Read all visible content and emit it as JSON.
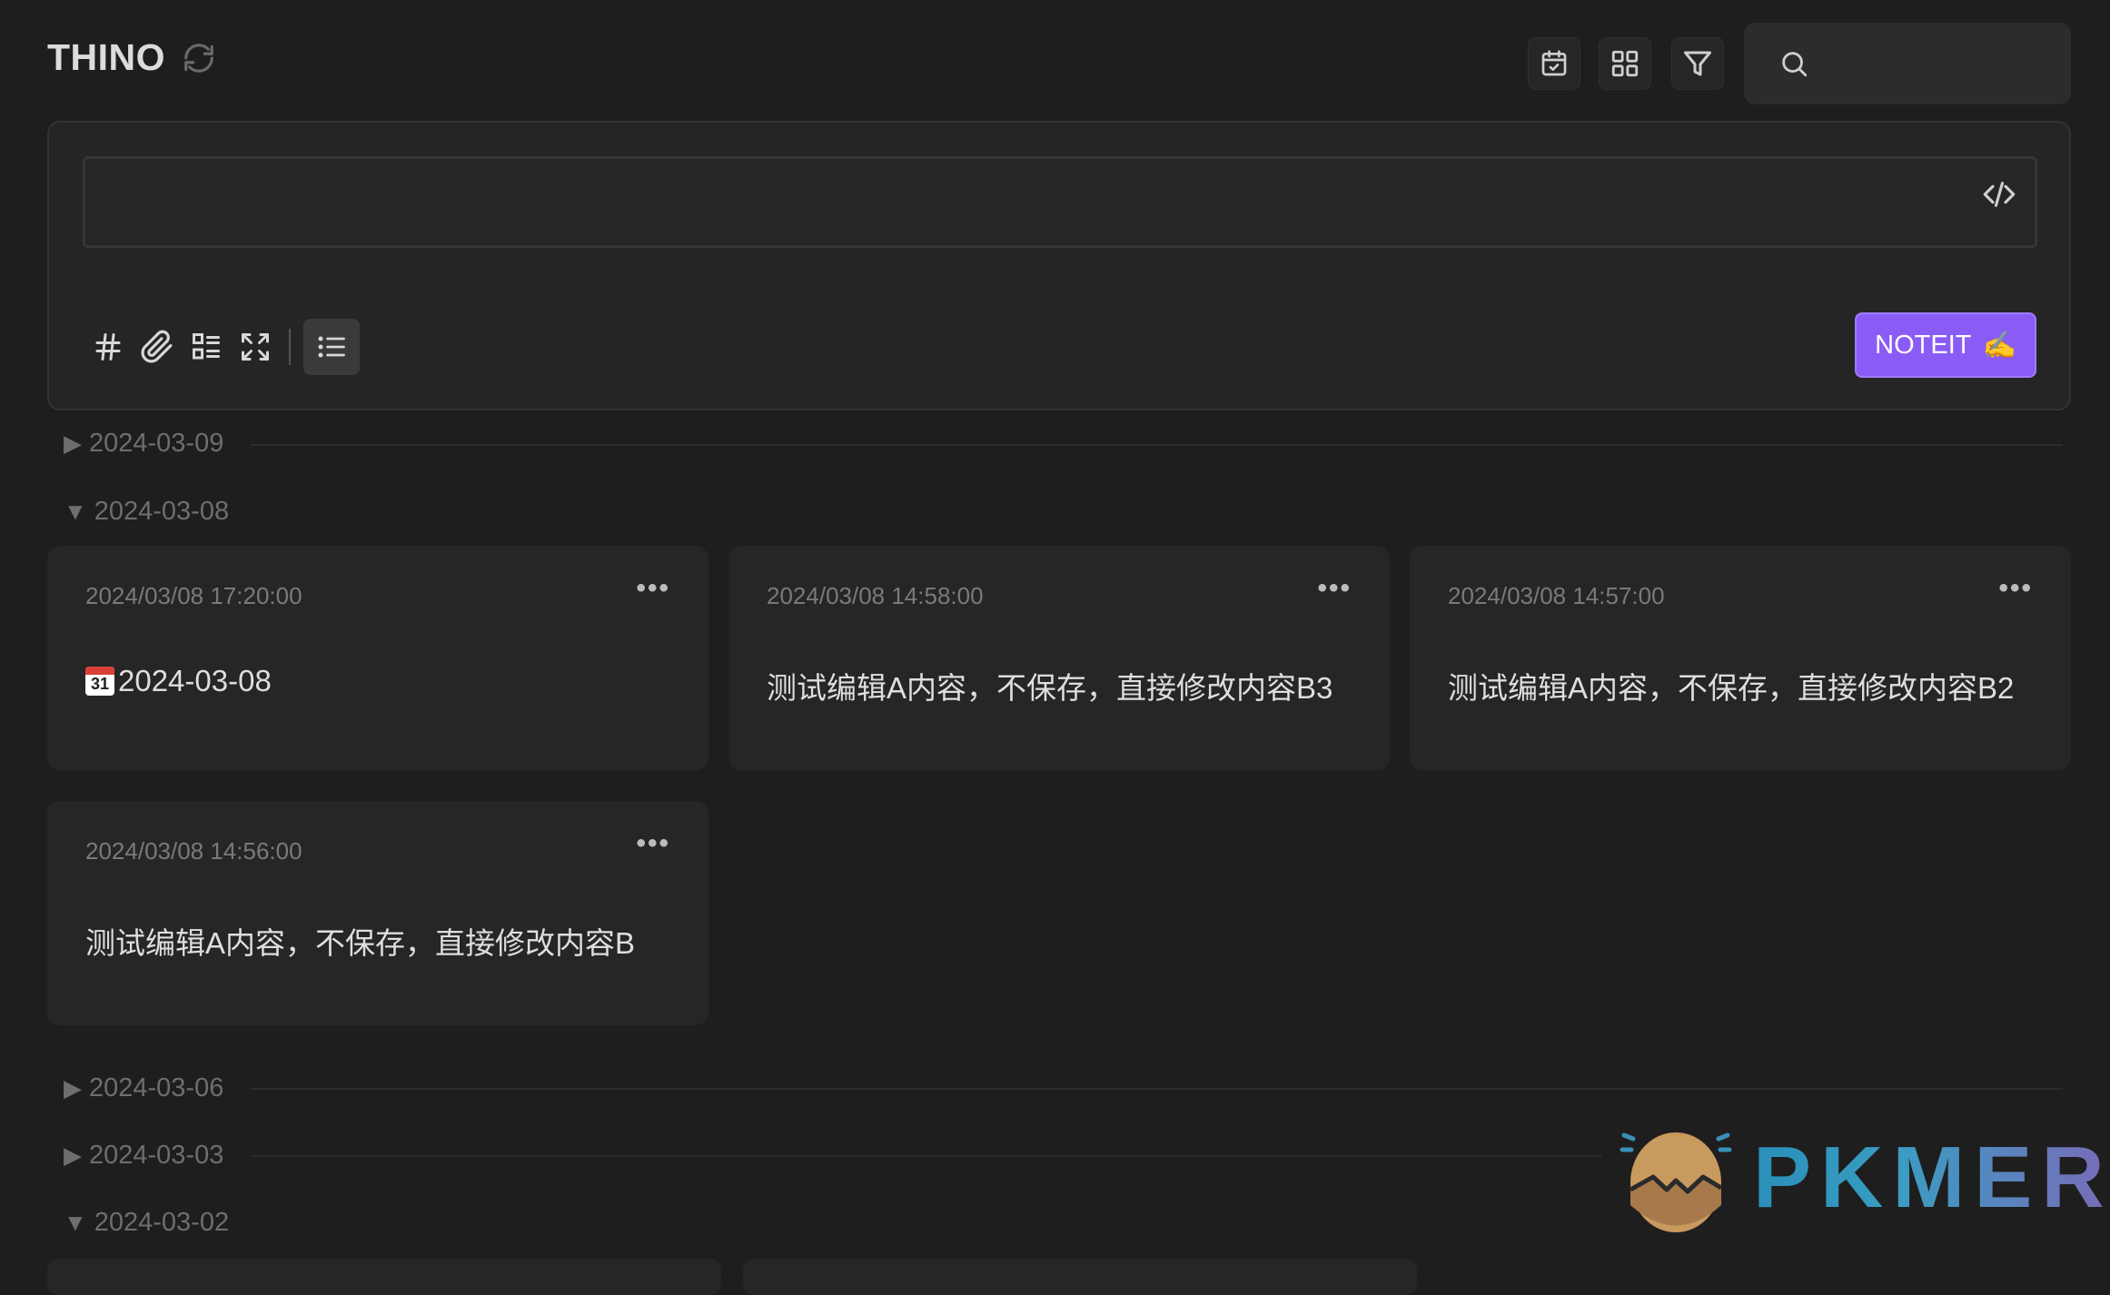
{
  "header": {
    "title": "THINO"
  },
  "search": {
    "placeholder": ""
  },
  "editor": {
    "value": "",
    "submit_label": "NOTEIT",
    "submit_emoji": "✍️"
  },
  "groups": [
    {
      "date": "2024-03-09",
      "expanded": false
    },
    {
      "date": "2024-03-08",
      "expanded": true
    },
    {
      "date": "2024-03-06",
      "expanded": false
    },
    {
      "date": "2024-03-03",
      "expanded": false
    },
    {
      "date": "2024-03-02",
      "expanded": true
    }
  ],
  "memos": [
    {
      "time": "2024/03/08 17:20:00",
      "content": "2024-03-08",
      "icon": "calendar-emoji"
    },
    {
      "time": "2024/03/08 14:58:00",
      "content": "测试编辑A内容，不保存，直接修改内容B3"
    },
    {
      "time": "2024/03/08 14:57:00",
      "content": "测试编辑A内容，不保存，直接修改内容B2"
    },
    {
      "time": "2024/03/08 14:56:00",
      "content": "测试编辑A内容，不保存，直接修改内容B"
    }
  ],
  "more_label": "•••",
  "calendar_emoji_day": "31",
  "watermark": {
    "text": "PKMER"
  },
  "colors": {
    "accent": "#8a5cf5",
    "background": "#1e1e1e",
    "card": "#262626"
  }
}
